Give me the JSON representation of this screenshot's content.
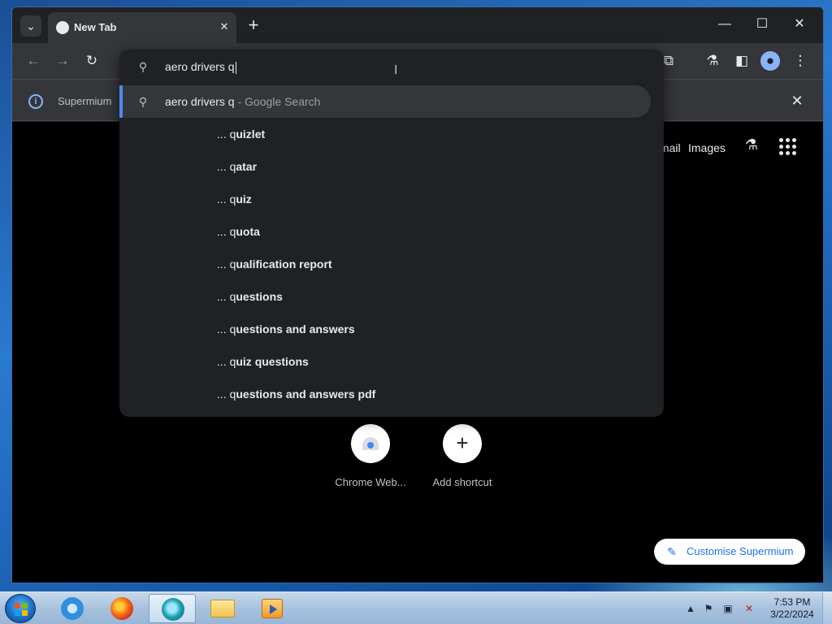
{
  "browser": {
    "tab": {
      "title": "New Tab",
      "close_glyph": "✕"
    },
    "new_tab_glyph": "+",
    "window_controls": {
      "minimize": "—",
      "maximize": "☐",
      "close": "✕"
    },
    "infobar": {
      "text": "Supermium",
      "close_glyph": "✕"
    }
  },
  "omnibox": {
    "input_value": "aero drivers q",
    "selected": {
      "query": "aero drivers q",
      "suffix": " - Google Search"
    },
    "suggestions": [
      {
        "prefix": "... ",
        "typed": "q",
        "rest": "uizlet"
      },
      {
        "prefix": "... ",
        "typed": "q",
        "rest": "atar"
      },
      {
        "prefix": "... ",
        "typed": "q",
        "rest": "uiz"
      },
      {
        "prefix": "... ",
        "typed": "q",
        "rest": "uota"
      },
      {
        "prefix": "... ",
        "typed": "q",
        "rest": "ualification report"
      },
      {
        "prefix": "... ",
        "typed": "q",
        "rest": "uestions"
      },
      {
        "prefix": "... ",
        "typed": "q",
        "rest": "uestions and answers"
      },
      {
        "prefix": "... ",
        "typed": "q",
        "rest": "uiz questions"
      },
      {
        "prefix": "... ",
        "typed": "q",
        "rest": "uestions and answers pdf"
      }
    ]
  },
  "ntp": {
    "links": {
      "gmail": "Gmail",
      "images": "Images"
    },
    "shortcuts": [
      {
        "label": "Chrome Web..."
      },
      {
        "label": "Add shortcut"
      }
    ],
    "customise_label": "Customise Supermium"
  },
  "taskbar": {
    "clock_time": "7:53 PM",
    "clock_date": "3/22/2024"
  },
  "colors": {
    "accent": "#4c8bf5",
    "omnibox_bg": "#202124",
    "toolbar_bg": "#35363a",
    "customise_text": "#1a73e8"
  }
}
